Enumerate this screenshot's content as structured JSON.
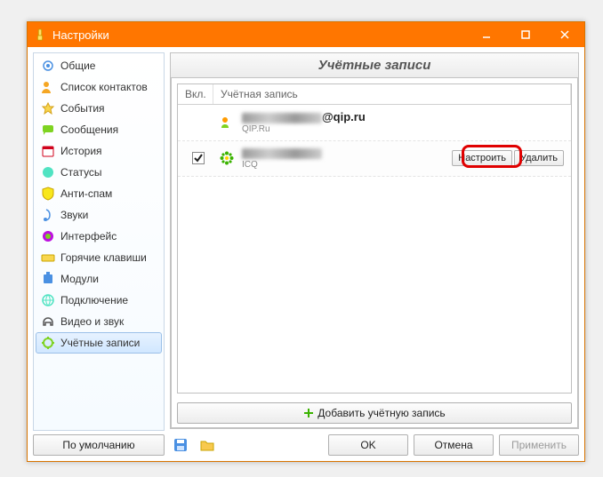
{
  "title": "Настройки",
  "sidebar": {
    "items": [
      {
        "label": "Общие"
      },
      {
        "label": "Список контактов"
      },
      {
        "label": "События"
      },
      {
        "label": "Сообщения"
      },
      {
        "label": "История"
      },
      {
        "label": "Статусы"
      },
      {
        "label": "Анти-спам"
      },
      {
        "label": "Звуки"
      },
      {
        "label": "Интерфейс"
      },
      {
        "label": "Горячие клавиши"
      },
      {
        "label": "Модули"
      },
      {
        "label": "Подключение"
      },
      {
        "label": "Видео и звук"
      },
      {
        "label": "Учётные записи"
      }
    ],
    "defaults_btn": "По умолчанию"
  },
  "panel": {
    "heading": "Учётные записи",
    "col_enabled": "Вкл.",
    "col_account": "Учётная запись",
    "add_button": "Добавить учётную запись"
  },
  "accounts": [
    {
      "name_suffix": "@qip.ru",
      "protocol": "QIP.Ru",
      "enabled": false
    },
    {
      "name_suffix": "",
      "protocol": "ICQ",
      "enabled": true
    }
  ],
  "row_actions": {
    "configure": "Настроить",
    "delete": "Удалить"
  },
  "footer": {
    "ok": "OK",
    "cancel": "Отмена",
    "apply": "Применить"
  }
}
